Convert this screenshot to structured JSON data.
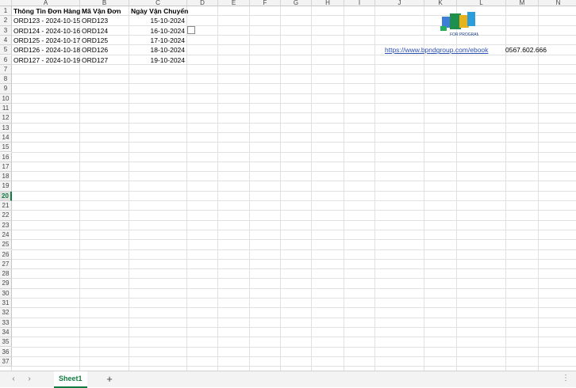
{
  "columns": [
    "A",
    "B",
    "C",
    "D",
    "E",
    "F",
    "G",
    "H",
    "I",
    "J",
    "K",
    "L",
    "M",
    "N"
  ],
  "rows": [
    "1",
    "2",
    "3",
    "4",
    "5",
    "6",
    "7",
    "8",
    "9",
    "10",
    "11",
    "12",
    "13",
    "14",
    "15",
    "16",
    "17",
    "18",
    "19",
    "20",
    "21",
    "22",
    "23",
    "24",
    "25",
    "26",
    "27",
    "28",
    "29",
    "30",
    "31",
    "32",
    "33",
    "34",
    "35",
    "36",
    "37"
  ],
  "selected_row": "20",
  "headers": {
    "info": "Thông Tin Đơn Hàng",
    "code": "Mã Vận Đơn",
    "date": "Ngày Vận Chuyển"
  },
  "data_rows": [
    {
      "info": "ORD123 - 2024-10-15",
      "code": "ORD123",
      "date": "15-10-2024"
    },
    {
      "info": "ORD124 - 2024-10-16",
      "code": "ORD124",
      "date": "16-10-2024"
    },
    {
      "info": "ORD125 - 2024-10-17",
      "code": "ORD125",
      "date": "17-10-2024"
    },
    {
      "info": "ORD126 - 2024-10-18",
      "code": "ORD126",
      "date": "18-10-2024"
    },
    {
      "info": "ORD127 - 2024-10-19",
      "code": "ORD127",
      "date": "19-10-2024"
    }
  ],
  "link": "https://www.bpndgroup.com/ebook",
  "phone": "0567.602.666",
  "logo_text": "FOR PROGRAM",
  "sheet_tab": "Sheet1",
  "add_sheet": "+",
  "nav_prev": "‹",
  "nav_next": "›",
  "more": "⋮"
}
